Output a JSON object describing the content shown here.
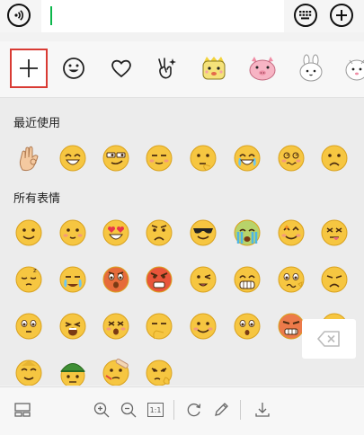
{
  "input": {
    "value": "",
    "placeholder": ""
  },
  "icons": {
    "voice": "voice-input-icon",
    "keyboard": "keyboard-icon",
    "more": "plus-circle-icon"
  },
  "tabs": [
    {
      "name": "add",
      "icon": "plus-icon",
      "selected": true
    },
    {
      "name": "emoji",
      "icon": "smiley-icon",
      "selected": false
    },
    {
      "name": "favorites",
      "icon": "heart-icon",
      "selected": false
    },
    {
      "name": "gestures",
      "icon": "victory-hand-icon",
      "selected": false
    },
    {
      "name": "sticker-pack-1",
      "icon": "yellow-creature-sticker-icon",
      "selected": false
    },
    {
      "name": "sticker-pack-2",
      "icon": "pink-pig-sticker-icon",
      "selected": false
    },
    {
      "name": "sticker-pack-3",
      "icon": "white-bunny-sticker-icon",
      "selected": false
    },
    {
      "name": "sticker-pack-4",
      "icon": "white-creature-sticker-icon",
      "selected": false
    }
  ],
  "sections": {
    "recent_title": "最近使用",
    "all_title": "所有表情"
  },
  "recent_emojis": [
    "ok-hand",
    "grin",
    "smirk-sunglasses",
    "sly",
    "thinking",
    "laugh-cry",
    "dizzy",
    "sad"
  ],
  "all_emojis": [
    "smile",
    "shy",
    "heart-eyes",
    "angry-frown",
    "cool-sunglasses",
    "crying-green",
    "wink-stars",
    "tongue-out",
    "sleepy",
    "tears",
    "angry-red",
    "furious",
    "wink",
    "big-grin",
    "doubt",
    "frown",
    "big-eyes",
    "scream",
    "dizzy-face",
    "pondering",
    "smile-simple",
    "surprised",
    "angry-hat",
    "smug",
    "gold-smile",
    "green-hat",
    "band-aid",
    "plead"
  ],
  "bottom_tools": [
    "layout-icon",
    "zoom-in-icon",
    "zoom-out-icon",
    "actual-size-icon",
    "rotate-icon",
    "edit-icon",
    "download-icon"
  ],
  "actual_size_label": "1:1",
  "colors": {
    "accent_green": "#0bb64b",
    "selected_tab_border": "#d93b34",
    "emoji_yellow": "#f6c641"
  }
}
